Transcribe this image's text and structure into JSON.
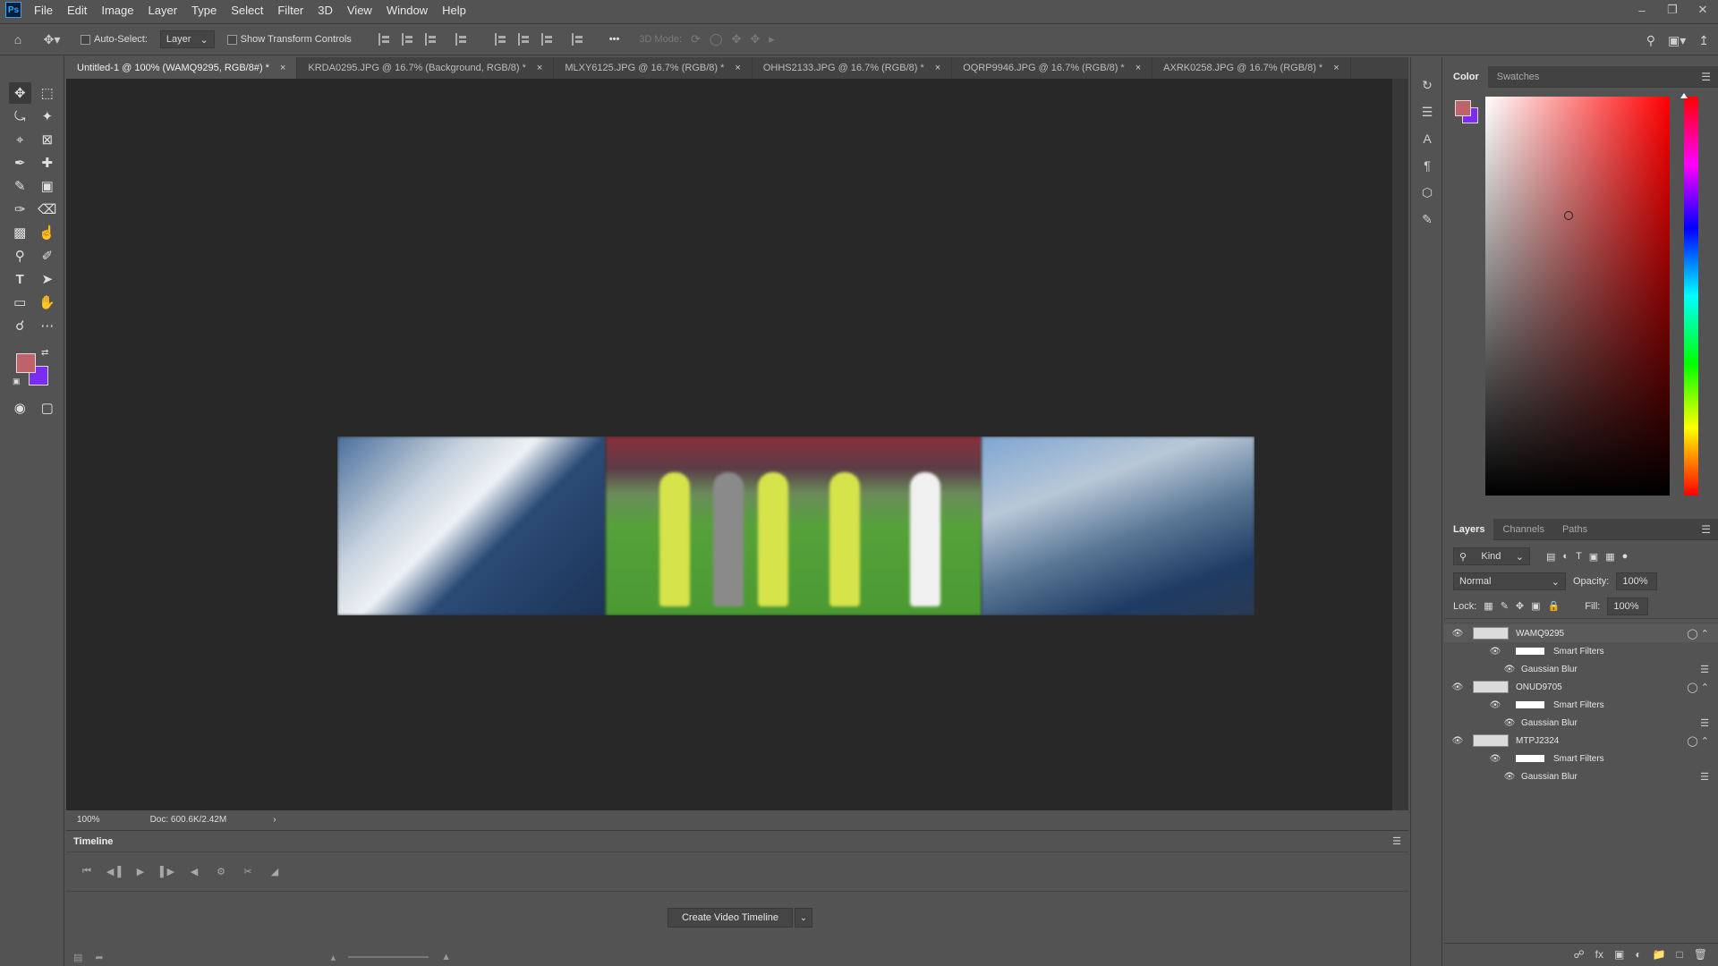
{
  "app": {
    "logo": "Ps",
    "menu": [
      "File",
      "Edit",
      "Image",
      "Layer",
      "Type",
      "Select",
      "Filter",
      "3D",
      "View",
      "Window",
      "Help"
    ]
  },
  "options": {
    "auto_select_label": "Auto-Select:",
    "layer_select": "Layer",
    "show_transform_label": "Show Transform Controls",
    "more": "•••",
    "mode_3d": "3D Mode:"
  },
  "tabs": [
    {
      "label": "Untitled-1 @ 100% (WAMQ9295, RGB/8#) *",
      "active": true
    },
    {
      "label": "KRDA0295.JPG @ 16.7% (Background, RGB/8) *",
      "active": false
    },
    {
      "label": "MLXY6125.JPG @ 16.7% (RGB/8) *",
      "active": false
    },
    {
      "label": "OHHS2133.JPG @ 16.7% (RGB/8) *",
      "active": false
    },
    {
      "label": "OQRP9946.JPG @ 16.7% (RGB/8) *",
      "active": false
    },
    {
      "label": "AXRK0258.JPG @ 16.7% (RGB/8) *",
      "active": false
    }
  ],
  "status": {
    "zoom": "100%",
    "doc": "Doc: 600.6K/2.42M"
  },
  "timeline": {
    "title": "Timeline",
    "create_button": "Create Video Timeline"
  },
  "color_panel": {
    "tabs": [
      "Color",
      "Swatches"
    ],
    "foreground": "#c0626a",
    "background": "#7a2cf0"
  },
  "layers_panel": {
    "tabs": [
      "Layers",
      "Channels",
      "Paths"
    ],
    "kind": "Kind",
    "blend_mode": "Normal",
    "opacity_label": "Opacity:",
    "opacity_value": "100%",
    "lock_label": "Lock:",
    "fill_label": "Fill:",
    "fill_value": "100%",
    "layers": [
      {
        "name": "WAMQ9295",
        "smart": "Smart Filters",
        "filter": "Gaussian Blur"
      },
      {
        "name": "ONUD9705",
        "smart": "Smart Filters",
        "filter": "Gaussian Blur"
      },
      {
        "name": "MTPJ2324",
        "smart": "Smart Filters",
        "filter": "Gaussian Blur"
      }
    ]
  }
}
